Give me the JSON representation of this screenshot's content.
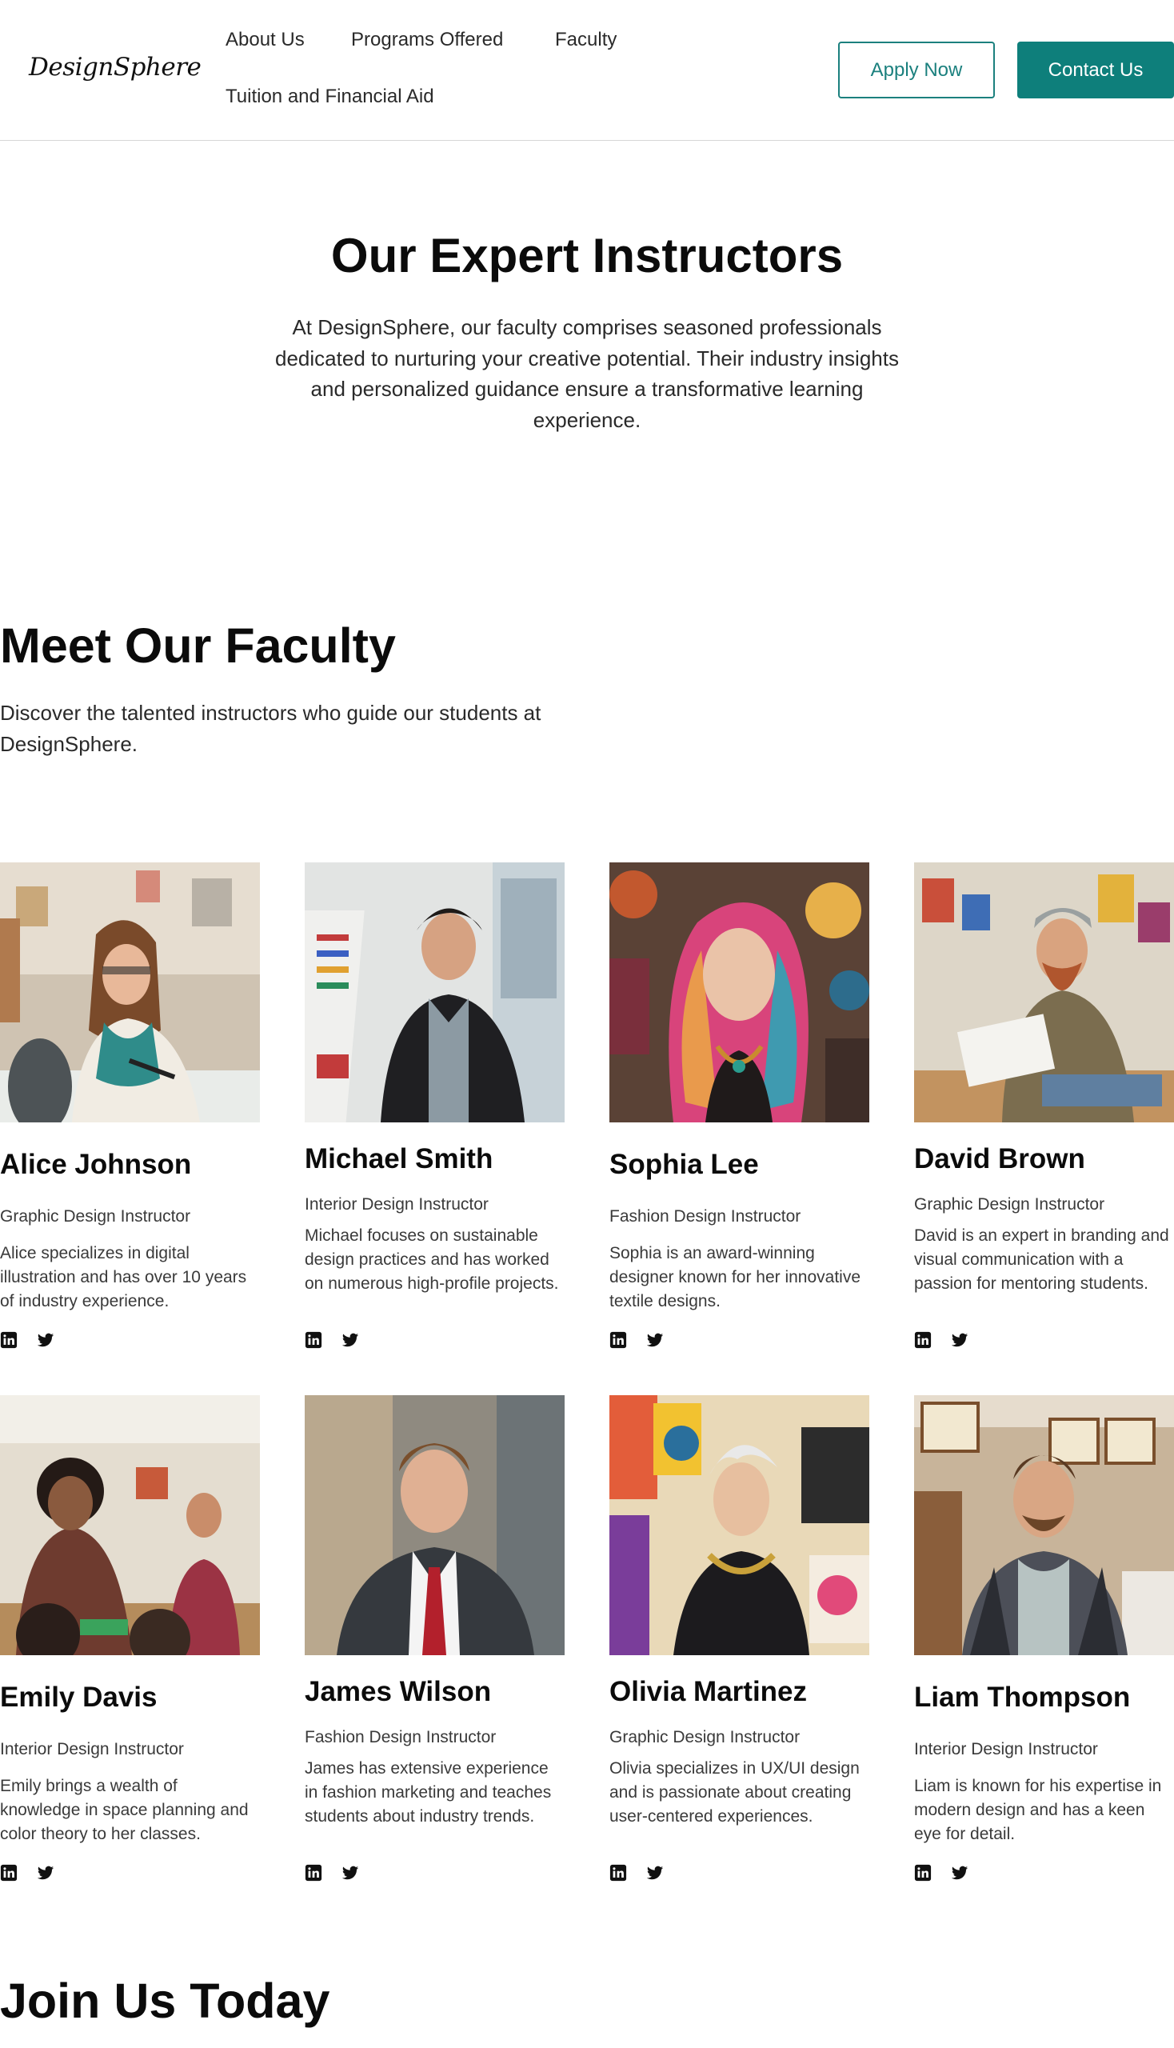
{
  "brand": {
    "logo_text": "DesignSphere",
    "accent_color": "#0e7f7b"
  },
  "nav": {
    "links": [
      {
        "label": "About Us"
      },
      {
        "label": "Programs Offered"
      },
      {
        "label": "Faculty"
      },
      {
        "label": "Tuition and Financial Aid"
      }
    ],
    "apply_label": "Apply Now",
    "contact_label": "Contact Us"
  },
  "hero": {
    "title": "Our Expert Instructors",
    "text": "At DesignSphere, our faculty comprises seasoned professionals dedicated to nurturing your creative potential. Their industry insights and personalized guidance ensure a transformative learning experience."
  },
  "faculty": {
    "title": "Meet Our Faculty",
    "subtitle": "Discover the talented instructors who guide our students at DesignSphere.",
    "members": [
      {
        "name": "Alice Johnson",
        "role": "Graphic Design Instructor",
        "bio": "Alice specializes in digital illustration and has over 10 years of industry experience."
      },
      {
        "name": "Michael Smith",
        "role": "Interior Design Instructor",
        "bio": "Michael focuses on sustainable design practices and has worked on numerous high-profile projects."
      },
      {
        "name": "Sophia Lee",
        "role": "Fashion Design Instructor",
        "bio": "Sophia is an award-winning designer known for her innovative textile designs."
      },
      {
        "name": "David Brown",
        "role": "Graphic Design Instructor",
        "bio": "David is an expert in branding and visual communication with a passion for mentoring students."
      },
      {
        "name": "Emily Davis",
        "role": "Interior Design Instructor",
        "bio": "Emily brings a wealth of knowledge in space planning and color theory to her classes."
      },
      {
        "name": "James Wilson",
        "role": "Fashion Design Instructor",
        "bio": "James has extensive experience in fashion marketing and teaches students about industry trends."
      },
      {
        "name": "Olivia Martinez",
        "role": "Graphic Design Instructor",
        "bio": "Olivia specializes in UX/UI design and is passionate about creating user-centered experiences."
      },
      {
        "name": "Liam Thompson",
        "role": "Interior Design Instructor",
        "bio": "Liam is known for his expertise in modern design and has a keen eye for detail."
      }
    ],
    "social_icons": [
      "linkedin-icon",
      "twitter-icon"
    ]
  },
  "join": {
    "title": "Join Us Today"
  }
}
